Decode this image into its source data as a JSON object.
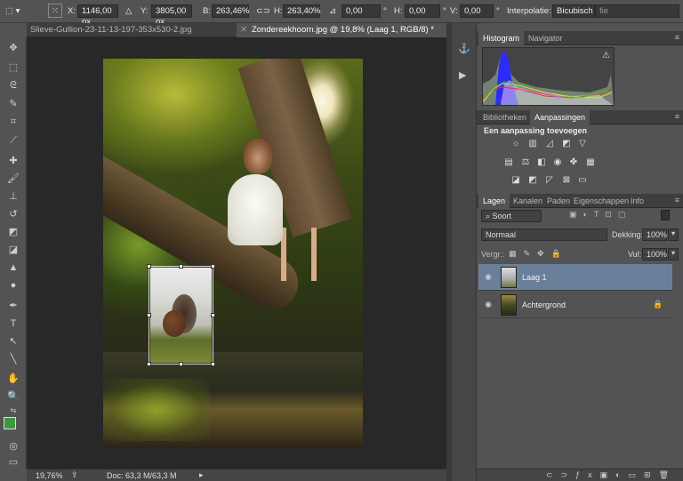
{
  "options_bar": {
    "x_label": "X:",
    "x_value": "1146,00 px",
    "y_label": "Y:",
    "y_value": "3805,00 px",
    "w_label": "B:",
    "w_value": "263,46%",
    "h_label": "H:",
    "h_value": "263,40%",
    "angle_value": "0,00",
    "angle_unit": "°",
    "hskew_label": "H:",
    "hskew_value": "0,00",
    "hskew_unit": "°",
    "vskew_label": "V:",
    "vskew_value": "0,00",
    "vskew_unit": "°",
    "interp_label": "Interpolatie:",
    "interp_value": "Bicubisch",
    "extra_field": "fie"
  },
  "tabs": [
    {
      "label": "Slieve-Gullion-23-11-13-197-353x530-2.jpg",
      "active": false
    },
    {
      "label": "Zondereekhoorn.jpg @ 19,8% (Laag 1, RGB/8) *",
      "active": true
    }
  ],
  "status": {
    "zoom": "19,76%",
    "doc": "Doc: 63,3 M/63,3 M"
  },
  "histogram": {
    "tabs": [
      "Histogram",
      "Navigator"
    ],
    "warning": "⚠"
  },
  "adjustments": {
    "tabs": [
      "Bibliotheken",
      "Aanpassingen"
    ],
    "heading": "Een aanpassing toevoegen"
  },
  "layers_panel": {
    "tabs": [
      "Lagen",
      "Kanalen",
      "Paden",
      "Eigenschappen",
      "Info"
    ],
    "filter_label": "Soort",
    "blend_mode": "Normaal",
    "opacity_label": "Dekking:",
    "opacity_value": "100%",
    "lock_label": "Vergr.:",
    "fill_label": "Vul:",
    "fill_value": "100%",
    "layers": [
      {
        "name": "Laag 1",
        "selected": true
      },
      {
        "name": "Achtergrond",
        "selected": false
      }
    ]
  }
}
